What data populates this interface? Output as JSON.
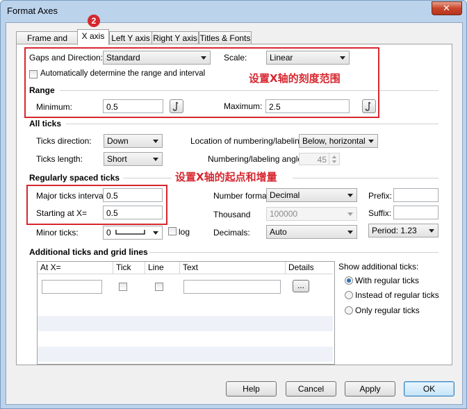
{
  "window": {
    "title": "Format Axes"
  },
  "tabs": [
    {
      "label": "Frame and Origin"
    },
    {
      "label": "X axis"
    },
    {
      "label": "Left Y axis"
    },
    {
      "label": "Right Y axis"
    },
    {
      "label": "Titles & Fonts"
    }
  ],
  "badge": "2",
  "gaps": {
    "label": "Gaps and Direction:",
    "value": "Standard"
  },
  "scale": {
    "label": "Scale:",
    "value": "Linear"
  },
  "auto_range": {
    "label": "Automatically determine the range and interval",
    "checked": false
  },
  "annotations": {
    "range_note": "设置X轴的刻度范围",
    "ticks_note": "设置X轴的起点和增量"
  },
  "range": {
    "heading": "Range",
    "min_label": "Minimum:",
    "min_value": "0.5",
    "max_label": "Maximum:",
    "max_value": "2.5"
  },
  "all_ticks": {
    "heading": "All ticks",
    "direction_label": "Ticks direction:",
    "direction_value": "Down",
    "length_label": "Ticks length:",
    "length_value": "Short",
    "location_label": "Location of numbering/labeling:",
    "location_value": "Below, horizontal",
    "angle_label": "Numbering/labeling angle:",
    "angle_value": "45"
  },
  "regular": {
    "heading": "Regularly spaced ticks",
    "major_label": "Major ticks interval:",
    "major_value": "0.5",
    "start_label": "Starting at X=",
    "start_value": "0.5",
    "minor_label": "Minor ticks:",
    "minor_value": "0",
    "log_label": "log",
    "format_label": "Number format:",
    "format_value": "Decimal",
    "thousand_label": "Thousand",
    "thousand_value": "100000",
    "decimals_label": "Decimals:",
    "decimals_value": "Auto",
    "prefix_label": "Prefix:",
    "prefix_value": "",
    "suffix_label": "Suffix:",
    "suffix_value": "",
    "period_value": "Period: 1.23"
  },
  "additional": {
    "heading": "Additional ticks and grid lines",
    "columns": [
      "At X=",
      "Tick",
      "Line",
      "Text",
      "Details"
    ],
    "details_button": "...",
    "show_label": "Show additional ticks:",
    "options": [
      {
        "label": "With regular ticks",
        "selected": true
      },
      {
        "label": "Instead of regular ticks",
        "selected": false
      },
      {
        "label": "Only regular ticks",
        "selected": false
      }
    ]
  },
  "buttons": {
    "help": "Help",
    "cancel": "Cancel",
    "apply": "Apply",
    "ok": "OK"
  },
  "colors": {
    "annotation": "#d7262e",
    "badge": "#d4282e",
    "titlebar": "#bcd3ec"
  }
}
